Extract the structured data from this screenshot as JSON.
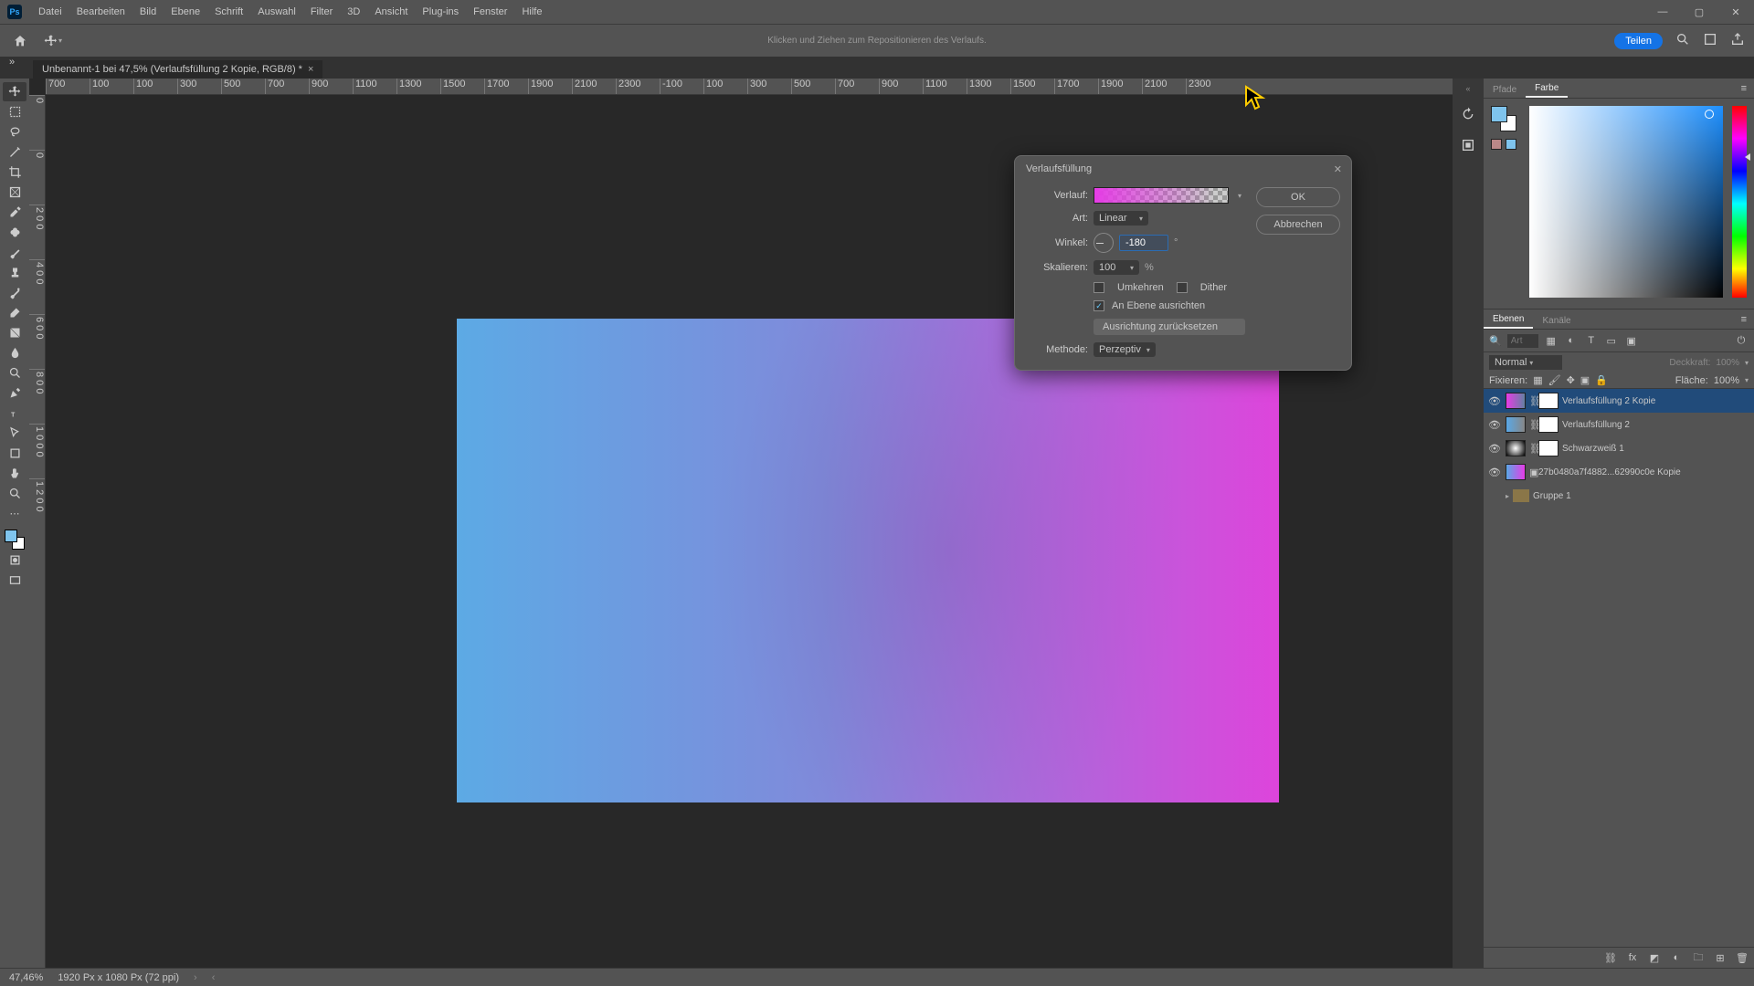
{
  "menu": {
    "items": [
      "Datei",
      "Bearbeiten",
      "Bild",
      "Ebene",
      "Schrift",
      "Auswahl",
      "Filter",
      "3D",
      "Ansicht",
      "Plug-ins",
      "Fenster",
      "Hilfe"
    ]
  },
  "optbar": {
    "hint": "Klicken und Ziehen zum Repositionieren des Verlaufs.",
    "share": "Teilen"
  },
  "tab": {
    "title": "Unbenannt-1 bei 47,5% (Verlaufsfüllung 2 Kopie, RGB/8) *"
  },
  "ruler_h": [
    "700",
    "100",
    "100",
    "300",
    "500",
    "700",
    "900",
    "1100",
    "1300",
    "1500",
    "1700",
    "1900",
    "2100",
    "2300",
    "-100",
    "100",
    "300",
    "500",
    "700",
    "900",
    "1100",
    "1300",
    "1500",
    "1700",
    "1900",
    "2100",
    "2300"
  ],
  "ruler_v": [
    "0",
    "0",
    "2 0 0",
    "4 0 0",
    "6 0 0",
    "8 0 0",
    "1 0 0 0",
    "1 2 0 0"
  ],
  "colorPanel": {
    "tabs": [
      "Pfade",
      "Farbe"
    ]
  },
  "layersPanel": {
    "tabs": [
      "Ebenen",
      "Kanäle"
    ],
    "searchHint": "Art",
    "blend": "Normal",
    "opacityLabel": "Deckkraft:",
    "opacity": "100%",
    "fixLabel": "Fixieren:",
    "fillLabel": "Fläche:",
    "fill": "100%",
    "layers": [
      {
        "name": "Verlaufsfüllung 2 Kopie",
        "sel": true,
        "kind": "grad"
      },
      {
        "name": "Verlaufsfüllung 2",
        "kind": "grad2"
      },
      {
        "name": "Schwarzweiß 1",
        "kind": "bw"
      },
      {
        "name": "27b0480a7f4882...62990c0e  Kopie",
        "kind": "img"
      },
      {
        "name": "Gruppe 1",
        "kind": "folder"
      }
    ]
  },
  "dialog": {
    "title": "Verlaufsfüllung",
    "ok": "OK",
    "cancel": "Abbrechen",
    "gradient": "Verlauf:",
    "style": "Art:",
    "styleVal": "Linear",
    "angle": "Winkel:",
    "angleVal": "-180",
    "scale": "Skalieren:",
    "scaleVal": "100",
    "scaleUnit": "%",
    "reverse": "Umkehren",
    "dither": "Dither",
    "align": "An Ebene ausrichten",
    "reset": "Ausrichtung zurücksetzen",
    "method": "Methode:",
    "methodVal": "Perzeptiv"
  },
  "status": {
    "zoom": "47,46%",
    "docinfo": "1920 Px x 1080 Px (72 ppi)"
  }
}
